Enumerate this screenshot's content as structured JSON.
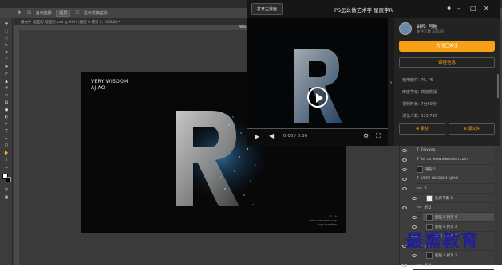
{
  "photoshop": {
    "options_bar": {
      "auto_select_label": "自动选择:",
      "layer_dropdown": "图层",
      "transform_label": "显示变换控件"
    },
    "doc_tab": "建文件-炫酷的-炫酷的.psd @ 98% (图层 8 拷贝 5, RGB/8) *",
    "ruler_text": "WISDOM",
    "document": {
      "line1": "VERY WISDOM",
      "line2": "AJIAO",
      "footer_line1": "07.16",
      "footer_line2": "www.viwisdom.com",
      "footer_line3": "copy together"
    },
    "layers": [
      {
        "name": "Feiyang",
        "type": "T",
        "thumb": "none"
      },
      {
        "name": "let us www.viwisdom.com",
        "type": "T",
        "thumb": "none"
      },
      {
        "name": "矩形 1",
        "type": "shape",
        "thumb": "dark"
      },
      {
        "name": "VERY WISDOM AJIAO",
        "type": "T",
        "thumb": "none"
      },
      {
        "name": "R",
        "type": "folder",
        "thumb": "none"
      },
      {
        "name": "色彩平衡 1",
        "type": "adj",
        "thumb": "white"
      },
      {
        "name": "组 2",
        "type": "folder",
        "thumb": "none"
      },
      {
        "name": "图层 8 拷贝 5",
        "type": "layer",
        "thumb": "dark"
      },
      {
        "name": "图层 8 拷贝 4",
        "type": "layer",
        "thumb": "dark"
      },
      {
        "name": "图层 8 拷贝 3",
        "type": "layer",
        "thumb": "dark"
      },
      {
        "name": "组 3",
        "type": "folder",
        "thumb": "none"
      },
      {
        "name": "图层 4 拷贝 2",
        "type": "layer",
        "thumb": "dark"
      },
      {
        "name": "组 4",
        "type": "folder",
        "thumb": "none"
      }
    ]
  },
  "video": {
    "back_button": "打开主界面",
    "title": "PS怎么做艺术字 星辰字R",
    "time": "0:00 / 0:00",
    "lecturer_label": "讲师:",
    "lecturer_name": "阿拖",
    "lecturer_sub": "关注人数 44839",
    "follow_button": "为他已关注",
    "course_info_button": "课程信息",
    "info_rows": [
      {
        "label": "使用软件:",
        "value": "PS, PS"
      },
      {
        "label": "难度等级:",
        "value": "高级挑战"
      },
      {
        "label": "视频时长:",
        "value": "7分59秒"
      },
      {
        "label": "浏览人数:",
        "value": "533,795"
      }
    ],
    "material_button": "素材",
    "source_button": "源文件",
    "accent_color": "#f7a016"
  },
  "watermark": "最需教育"
}
